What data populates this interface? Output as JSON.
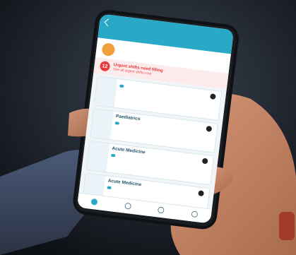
{
  "status": {
    "time": "",
    "battery": ""
  },
  "nav": {
    "title": ""
  },
  "shift": {
    "line1": "",
    "line2": "",
    "time": ""
  },
  "alert": {
    "count": "12",
    "title": "Urgent shifts need filling",
    "link": "See all urgent shifts now"
  },
  "cards": [
    {
      "day": "",
      "month": "",
      "title": "",
      "sub": "",
      "rate": "",
      "slot": ""
    },
    {
      "day": "",
      "month": "",
      "title": "Paediatrics",
      "sub": "",
      "rate": "",
      "slot": ""
    },
    {
      "day": "",
      "month": "",
      "title": "Acute Medicine",
      "sub": "",
      "rate": "",
      "slot": ""
    },
    {
      "day": "",
      "month": "",
      "title": "Acute Medicine",
      "sub": "",
      "rate": "",
      "slot": ""
    }
  ],
  "tabs": [
    "",
    "",
    "",
    ""
  ]
}
